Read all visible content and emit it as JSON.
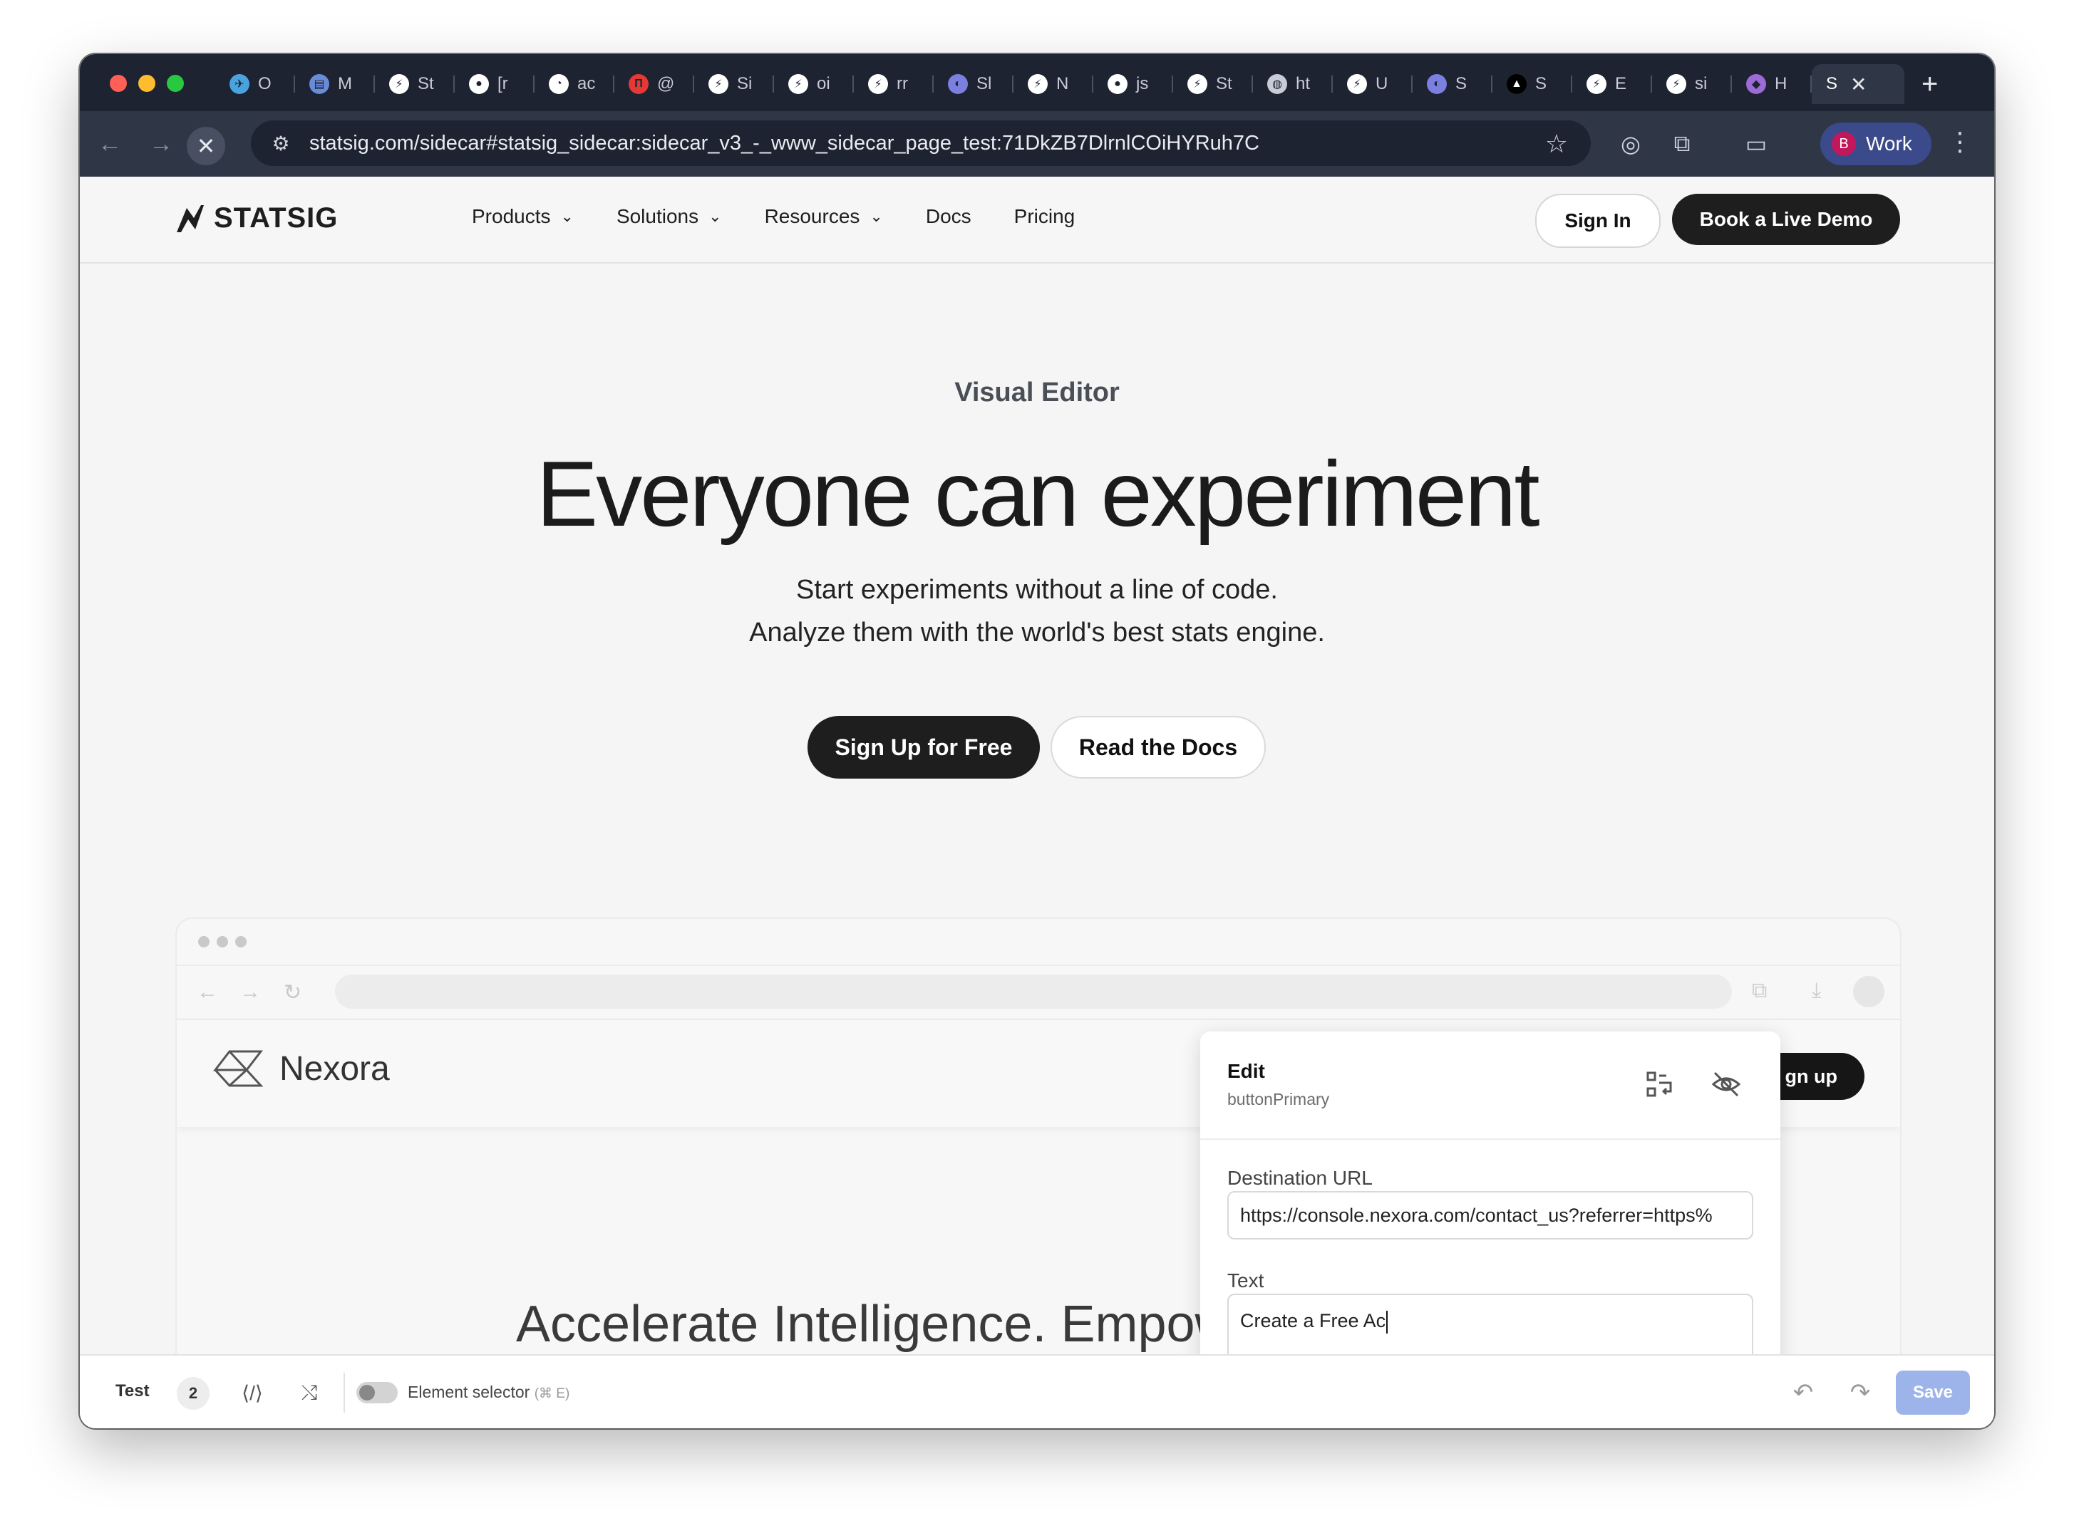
{
  "browser": {
    "tabs": [
      {
        "label": "O",
        "icon": "telegram-icon",
        "color": "#4aa3df"
      },
      {
        "label": "M",
        "icon": "chart-icon",
        "color": "#6a8cd8"
      },
      {
        "label": "St",
        "icon": "statsig-icon",
        "color": "#ffffff"
      },
      {
        "label": "[r",
        "icon": "github-icon",
        "color": "#ffffff"
      },
      {
        "label": "ac",
        "icon": "github-loading-icon",
        "color": "#ffffff"
      },
      {
        "label": "@",
        "icon": "red-app-icon",
        "color": "#e53935"
      },
      {
        "label": "Si",
        "icon": "statsig-icon",
        "color": "#ffffff"
      },
      {
        "label": "oi",
        "icon": "statsig-icon",
        "color": "#ffffff"
      },
      {
        "label": "rr",
        "icon": "statsig-icon",
        "color": "#ffffff"
      },
      {
        "label": "Sl",
        "icon": "linear-icon",
        "color": "#7b7fe0"
      },
      {
        "label": "N",
        "icon": "statsig-icon",
        "color": "#ffffff"
      },
      {
        "label": "js",
        "icon": "github-icon",
        "color": "#ffffff"
      },
      {
        "label": "St",
        "icon": "statsig-icon",
        "color": "#ffffff"
      },
      {
        "label": "ht",
        "icon": "globe-icon",
        "color": "#c7ccd6"
      },
      {
        "label": "U",
        "icon": "statsig-icon",
        "color": "#ffffff"
      },
      {
        "label": "S",
        "icon": "linear-icon",
        "color": "#7b7fe0"
      },
      {
        "label": "S",
        "icon": "vercel-icon",
        "color": "#000000"
      },
      {
        "label": "E",
        "icon": "statsig-icon",
        "color": "#ffffff"
      },
      {
        "label": "si",
        "icon": "statsig-icon",
        "color": "#ffffff"
      },
      {
        "label": "H",
        "icon": "purple-app-icon",
        "color": "#9c6bd6"
      },
      {
        "label": "S",
        "icon": "none",
        "color": "#ffffff",
        "active": true
      }
    ],
    "url": "statsig.com/sidecar#statsig_sidecar:sidecar_v3_-_www_sidecar_page_test:71DkZB7DlrnlCOiHYRuh7C",
    "profile_initial": "B",
    "profile_label": "Work",
    "new_tab": "+",
    "close": "✕"
  },
  "site": {
    "logo": "STATSIG",
    "nav": [
      "Products",
      "Solutions",
      "Resources",
      "Docs",
      "Pricing"
    ],
    "sign_in": "Sign In",
    "book_demo": "Book a Live Demo",
    "eyebrow": "Visual Editor",
    "headline": "Everyone can experiment",
    "sub_line1": "Start experiments without a line of code.",
    "sub_line2": "Analyze them with the world's best stats engine.",
    "cta_primary": "Sign Up for Free",
    "cta_secondary": "Read the Docs"
  },
  "mock": {
    "brand": "Nexora",
    "signup_label": "gn up",
    "hero_text": "Accelerate Intelligence. Empow"
  },
  "edit_panel": {
    "title": "Edit",
    "subtitle": "buttonPrimary",
    "dest_label": "Destination URL",
    "dest_value": "https://console.nexora.com/contact_us?referrer=https%",
    "text_label": "Text",
    "text_value": "Create a Free Ac"
  },
  "sidecar_bar": {
    "test_label": "Test",
    "count": "2",
    "selector_label": "Element selector",
    "selector_hint": "(⌘ E)",
    "save_label": "Save"
  },
  "colors": {
    "accent_save": "#9db4ea",
    "dark_button": "#1e1e1e",
    "tabbar": "#1d2330"
  }
}
